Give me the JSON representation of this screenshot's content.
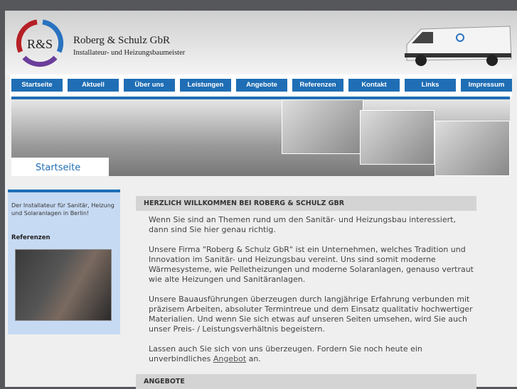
{
  "header": {
    "company": "Roberg & Schulz GbR",
    "subtitle": "Installateur- und Heizungsbaumeister",
    "logo_text": "R&S"
  },
  "nav": [
    "Startseite",
    "Aktuell",
    "Über uns",
    "Leistungen",
    "Angebote",
    "Referenzen",
    "Kontakt",
    "Links",
    "Impressum"
  ],
  "banner": {
    "label": "Startseite"
  },
  "sidebar": {
    "text": "Der Installateur für Sanitär, Heizung und Solaranlagen in Berlin!",
    "ref_title": "Referenzen"
  },
  "main": {
    "heading": "HERZLICH WILLKOMMEN BEI ROBERG & SCHULZ GBR",
    "p1": "Wenn Sie sind an Themen rund um den Sanitär- und Heizungsbau interessiert, dann sind Sie hier genau richtig.",
    "p2": "Unsere Firma \"Roberg & Schulz GbR\" ist ein Unternehmen, welches Tradition und Innovation im Sanitär- und Heizungsbau vereint. Uns sind somit moderne Wärmesysteme, wie Pelletheizungen und moderne Solaranlagen, genauso vertraut wie alte Heizungen und Sanitäranlagen.",
    "p3": "Unsere Bauausführungen überzeugen durch langjährige Erfahrung verbunden mit präzisem Arbeiten, absoluter Termintreue und dem Einsatz qualitativ hochwertiger Materialien. Und wenn Sie sich etwas auf unseren Seiten umsehen, wird Sie auch unser Preis- / Leistungsverhältnis begeistern.",
    "p4_before": "Lassen auch Sie sich von uns überzeugen. Fordern Sie noch heute ein unverbindliches ",
    "p4_link": "Angebot",
    "p4_after": " an.",
    "heading2": "ANGEBOTE"
  }
}
